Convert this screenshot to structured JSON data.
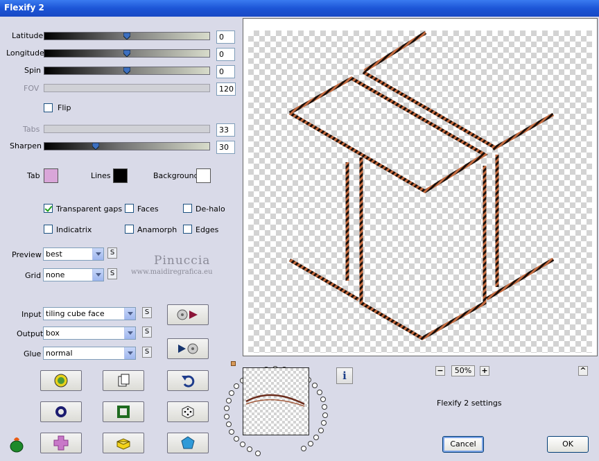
{
  "window": {
    "title": "Flexify 2"
  },
  "sliders": [
    {
      "label": "Latitude",
      "value": "0",
      "position": 0.5,
      "enabled": true
    },
    {
      "label": "Longitude",
      "value": "0",
      "position": 0.5,
      "enabled": true
    },
    {
      "label": "Spin",
      "value": "0",
      "position": 0.5,
      "enabled": true
    },
    {
      "label": "FOV",
      "value": "120",
      "enabled": false
    },
    {
      "label": "Tabs",
      "value": "33",
      "enabled": false
    },
    {
      "label": "Sharpen",
      "value": "30",
      "position": 0.3,
      "enabled": true
    }
  ],
  "flip": {
    "label": "Flip",
    "checked": false
  },
  "colors": {
    "tab": {
      "label": "Tab",
      "color": "#d9a6d9"
    },
    "lines": {
      "label": "Lines",
      "color": "#000000"
    },
    "background": {
      "label": "Background",
      "color": "#ffffff"
    }
  },
  "options": [
    {
      "label": "Transparent gaps",
      "checked": true
    },
    {
      "label": "Faces",
      "checked": false
    },
    {
      "label": "De-halo",
      "checked": false
    },
    {
      "label": "Indicatrix",
      "checked": false
    },
    {
      "label": "Anamorph",
      "checked": false
    },
    {
      "label": "Edges",
      "checked": false
    }
  ],
  "dropdowns": {
    "preview": {
      "label": "Preview",
      "value": "best"
    },
    "grid": {
      "label": "Grid",
      "value": "none"
    },
    "input": {
      "label": "Input",
      "value": "tiling cube face"
    },
    "output": {
      "label": "Output",
      "value": "box"
    },
    "glue": {
      "label": "Glue",
      "value": "normal"
    }
  },
  "small_button_label": "S",
  "watermark": {
    "name": "Pinuccia",
    "site": "www.maidiregrafica.eu"
  },
  "zoom": {
    "minus": "−",
    "value": "50%",
    "plus": "+",
    "collapse": "^"
  },
  "settings_label": "Flexify 2 settings",
  "buttons": {
    "cancel": "Cancel",
    "ok": "OK"
  },
  "info_label": "i"
}
